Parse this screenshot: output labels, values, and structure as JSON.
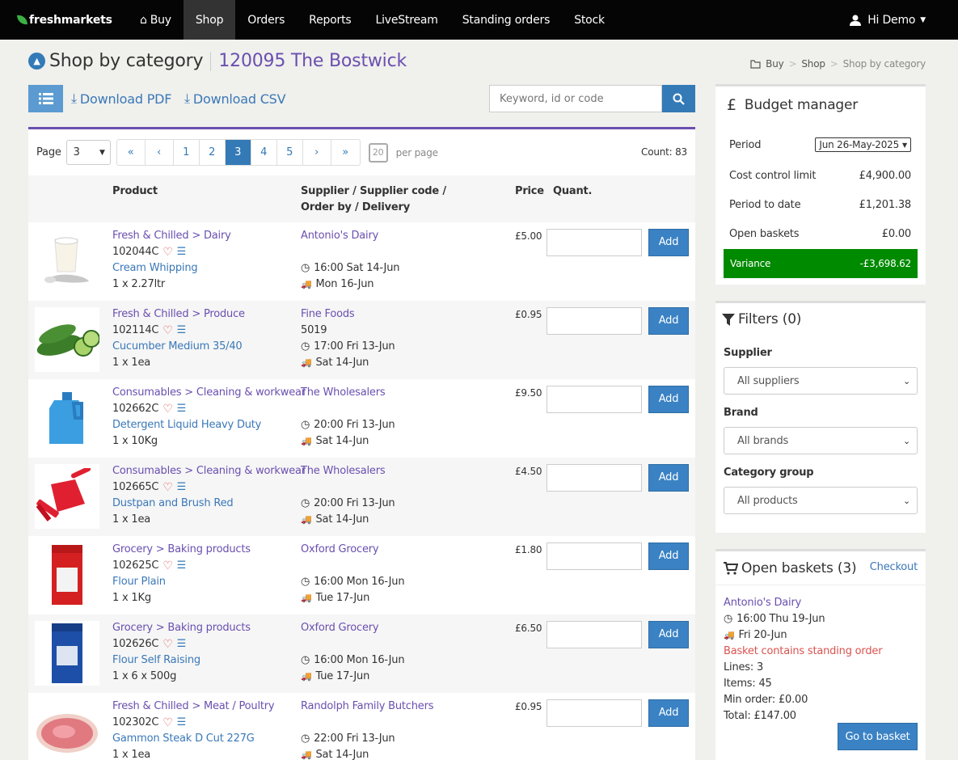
{
  "brand": "freshmarkets",
  "nav": {
    "items": [
      "Buy",
      "Shop",
      "Orders",
      "Reports",
      "LiveStream",
      "Standing orders",
      "Stock"
    ],
    "user": "Hi Demo"
  },
  "header": {
    "title": "Shop by category",
    "store": "120095 The Bostwick"
  },
  "breadcrumb": [
    "Buy",
    "Shop",
    "Shop by category"
  ],
  "toolbar": {
    "pdf": "Download PDF",
    "csv": "Download CSV",
    "search_placeholder": "Keyword, id or code"
  },
  "pager": {
    "label": "Page",
    "selected": "3",
    "pages": [
      "1",
      "2",
      "3",
      "4",
      "5"
    ],
    "per_page": "20",
    "per_page_label": "per page",
    "count": "Count: 83"
  },
  "table": {
    "headers": {
      "product": "Product",
      "supplier1": "Supplier / Supplier code /",
      "supplier2": "Order by / Delivery",
      "price": "Price",
      "qty": "Quant."
    },
    "add_label": "Add"
  },
  "products": [
    {
      "cat": "Fresh & Chilled > Dairy",
      "code": "102044C",
      "name": "Cream Whipping",
      "size": "1 x 2.27ltr",
      "supplier": "Antonio's Dairy",
      "supcode": "",
      "cutoff": "16:00 Sat 14-Jun",
      "delivery": "Mon 16-Jun",
      "price": "£5.00",
      "img": "yogurt"
    },
    {
      "cat": "Fresh & Chilled > Produce",
      "code": "102114C",
      "name": "Cucumber Medium 35/40",
      "size": "1 x 1ea",
      "supplier": "Fine Foods",
      "supcode": "5019",
      "cutoff": "17:00 Fri 13-Jun",
      "delivery": "Sat 14-Jun",
      "price": "£0.95",
      "img": "cucumber"
    },
    {
      "cat": "Consumables > Cleaning & workwear",
      "code": "102662C",
      "name": "Detergent Liquid Heavy Duty",
      "size": "1 x 10Kg",
      "supplier": "The Wholesalers",
      "supcode": "",
      "cutoff": "20:00 Fri 13-Jun",
      "delivery": "Sat 14-Jun",
      "price": "£9.50",
      "img": "detergent"
    },
    {
      "cat": "Consumables > Cleaning & workwear",
      "code": "102665C",
      "name": "Dustpan and Brush Red",
      "size": "1 x 1ea",
      "supplier": "The Wholesalers",
      "supcode": "",
      "cutoff": "20:00 Fri 13-Jun",
      "delivery": "Sat 14-Jun",
      "price": "£4.50",
      "img": "dustpan"
    },
    {
      "cat": "Grocery > Baking products",
      "code": "102625C",
      "name": "Flour Plain",
      "size": "1 x 1Kg",
      "supplier": "Oxford Grocery",
      "supcode": "",
      "cutoff": "16:00 Mon 16-Jun",
      "delivery": "Tue 17-Jun",
      "price": "£1.80",
      "img": "flour-red"
    },
    {
      "cat": "Grocery > Baking products",
      "code": "102626C",
      "name": "Flour Self Raising",
      "size": "1 x 6 x 500g",
      "supplier": "Oxford Grocery",
      "supcode": "",
      "cutoff": "16:00 Mon 16-Jun",
      "delivery": "Tue 17-Jun",
      "price": "£6.50",
      "img": "flour-blue"
    },
    {
      "cat": "Fresh & Chilled > Meat / Poultry",
      "code": "102302C",
      "name": "Gammon Steak D Cut 227G",
      "size": "1 x 1ea",
      "supplier": "Randolph Family Butchers",
      "supcode": "",
      "cutoff": "22:00 Fri 13-Jun",
      "delivery": "Sat 14-Jun",
      "price": "£0.95",
      "img": "gammon"
    }
  ],
  "budget": {
    "title": "Budget manager",
    "period_label": "Period",
    "period_value": "Jun 26-May-2025",
    "ccl_label": "Cost control limit",
    "ccl": "£4,900.00",
    "ptd_label": "Period to date",
    "ptd": "£1,201.38",
    "ob_label": "Open baskets",
    "ob": "£0.00",
    "var_label": "Variance",
    "var": "-£3,698.62"
  },
  "filters": {
    "title": "Filters (0)",
    "supplier_label": "Supplier",
    "supplier_value": "All suppliers",
    "brand_label": "Brand",
    "brand_value": "All brands",
    "catgroup_label": "Category group",
    "catgroup_value": "All products"
  },
  "baskets": {
    "title": "Open baskets (3)",
    "checkout": "Checkout",
    "supplier": "Antonio's Dairy",
    "cutoff": "16:00 Thu 19-Jun",
    "delivery": "Fri 20-Jun",
    "standing": "Basket contains standing order",
    "lines": "Lines: 3",
    "items": "Items: 45",
    "min": "Min order: £0.00",
    "total": "Total: £147.00",
    "go": "Go to basket"
  },
  "colors": {
    "accent": "#6a4fb0",
    "primary": "#337ab7",
    "variance": "#008a00",
    "standing": "#d9534f"
  }
}
